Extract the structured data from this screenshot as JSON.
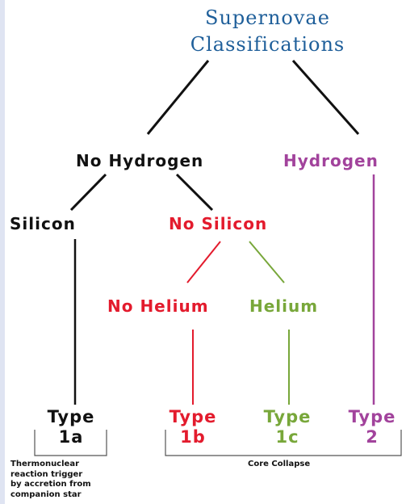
{
  "title": [
    "Supernovae",
    "Classifications"
  ],
  "nodes": {
    "no_hydrogen": "No Hydrogen",
    "hydrogen": "Hydrogen",
    "silicon": "Silicon",
    "no_silicon": "No Silicon",
    "no_helium": "No Helium",
    "helium": "Helium"
  },
  "types": {
    "t1a": [
      "Type",
      "1a"
    ],
    "t1b": [
      "Type",
      "1b"
    ],
    "t1c": [
      "Type",
      "1c"
    ],
    "t2": [
      "Type",
      "2"
    ]
  },
  "captions": {
    "thermonuclear": [
      "Thermonuclear",
      "reaction trigger",
      "by accretion from",
      "companion star"
    ],
    "core_collapse": "Core Collapse"
  },
  "colors": {
    "title": "#1f5f9a",
    "black": "#111111",
    "red": "#e31b2d",
    "green": "#78a73a",
    "purple": "#a2439c"
  }
}
